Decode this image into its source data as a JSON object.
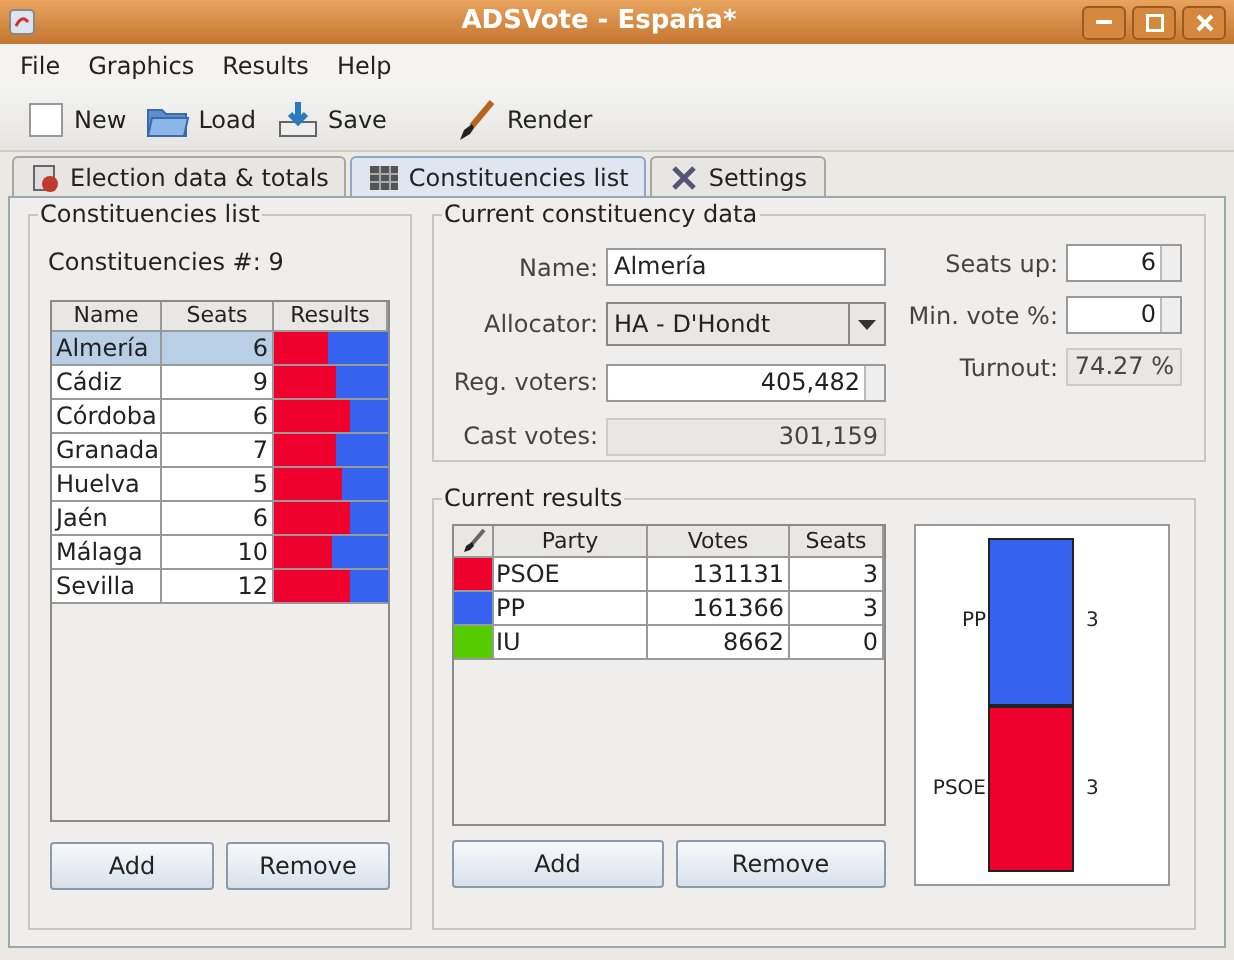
{
  "window": {
    "title": "ADSVote - España*"
  },
  "menu": [
    "File",
    "Graphics",
    "Results",
    "Help"
  ],
  "toolbar": [
    {
      "kind": "new",
      "label": "New"
    },
    {
      "kind": "load",
      "label": "Load"
    },
    {
      "kind": "save",
      "label": "Save"
    },
    {
      "kind": "render",
      "label": "Render"
    }
  ],
  "tabs": [
    {
      "kind": "election",
      "label": "Election data & totals",
      "selected": false
    },
    {
      "kind": "list",
      "label": "Constituencies list",
      "selected": true
    },
    {
      "kind": "settings",
      "label": "Settings",
      "selected": false
    }
  ],
  "constituencies": {
    "title": "Constituencies list",
    "count_label": "Constituencies #:",
    "count": "9",
    "columns": [
      "Name",
      "Seats",
      "Results"
    ],
    "rows": [
      {
        "name": "Almería",
        "seats": "6",
        "level": 0.48,
        "selected": true
      },
      {
        "name": "Cádiz",
        "seats": "9",
        "level": 0.55,
        "selected": false
      },
      {
        "name": "Córdoba",
        "seats": "6",
        "level": 0.66,
        "selected": false
      },
      {
        "name": "Granada",
        "seats": "7",
        "level": 0.55,
        "selected": false
      },
      {
        "name": "Huelva",
        "seats": "5",
        "level": 0.6,
        "selected": false
      },
      {
        "name": "Jaén",
        "seats": "6",
        "level": 0.66,
        "selected": false
      },
      {
        "name": "Málaga",
        "seats": "10",
        "level": 0.5,
        "selected": false
      },
      {
        "name": "Sevilla",
        "seats": "12",
        "level": 0.66,
        "selected": false
      }
    ],
    "buttons": [
      "Add",
      "Remove"
    ]
  },
  "current_data": {
    "title": "Current constituency data",
    "name_label": "Name:",
    "name": "Almería",
    "allocator_label": "Allocator:",
    "allocator": "HA - D'Hondt",
    "reg_voters_label": "Reg. voters:",
    "reg_voters": "405,482",
    "cast_votes_label": "Cast votes:",
    "cast_votes": "301,159",
    "seats_up_label": "Seats up:",
    "seats_up": "6",
    "min_vote_label": "Min. vote %:",
    "min_vote": "0",
    "turnout_label": "Turnout:",
    "turnout": "74.27 %"
  },
  "current_results": {
    "title": "Current results",
    "columns": [
      "Party",
      "Votes",
      "Seats"
    ],
    "rows": [
      {
        "color": "#f0002c",
        "party": "PSOE",
        "votes": "131131",
        "seats": "3"
      },
      {
        "color": "#3563f0",
        "party": "PP",
        "votes": "161366",
        "seats": "3"
      },
      {
        "color": "#55cc00",
        "party": "IU",
        "votes": "8662",
        "seats": "0"
      }
    ],
    "buttons": [
      "Add",
      "Remove"
    ],
    "seat_chart": [
      {
        "party": "PP",
        "seats": "3",
        "color": "#3563f0"
      },
      {
        "party": "PSOE",
        "seats": "3",
        "color": "#f0002c"
      }
    ]
  }
}
